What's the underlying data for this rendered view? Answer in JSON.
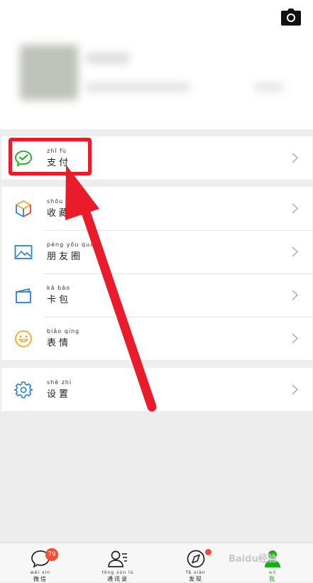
{
  "profile": {
    "blurred": true
  },
  "groups": {
    "pay": [
      {
        "name": "pay",
        "pinyin": "zhī fù",
        "label": "支付",
        "icon": "wechat-pay-icon",
        "color": "#1aad19"
      }
    ],
    "main": [
      {
        "name": "favorites",
        "pinyin": "shōu cáng",
        "label": "收藏",
        "icon": "cube-icon"
      },
      {
        "name": "moments",
        "pinyin": "péng yǒu quān",
        "label": "朋友圈",
        "icon": "picture-icon",
        "color": "#2782d7"
      },
      {
        "name": "cards",
        "pinyin": "kǎ bāo",
        "label": "卡包",
        "icon": "wallet-icon",
        "color": "#2782d7"
      },
      {
        "name": "stickers",
        "pinyin": "biǎo qíng",
        "label": "表情",
        "icon": "smiley-icon",
        "color": "#f5a623"
      }
    ],
    "settings": [
      {
        "name": "settings",
        "pinyin": "shè zhì",
        "label": "设置",
        "icon": "gear-icon",
        "color": "#2782d7"
      }
    ]
  },
  "annotation": {
    "color": "#ea1c2b"
  },
  "tabbar": {
    "tabs": [
      {
        "name": "chats",
        "pinyin": "wēi xìn",
        "label": "微信",
        "icon": "chat-bubble-icon",
        "badge": "79"
      },
      {
        "name": "contacts",
        "pinyin": "tōng xùn lù",
        "label": "通讯录",
        "icon": "contacts-icon"
      },
      {
        "name": "discover",
        "pinyin": "fā xiàn",
        "label": "发现",
        "icon": "compass-icon",
        "dot": true
      },
      {
        "name": "me",
        "pinyin": "wǒ",
        "label": "我",
        "icon": "person-icon",
        "active": true,
        "color": "#1aad19"
      }
    ]
  },
  "watermark": "Baidu经验"
}
